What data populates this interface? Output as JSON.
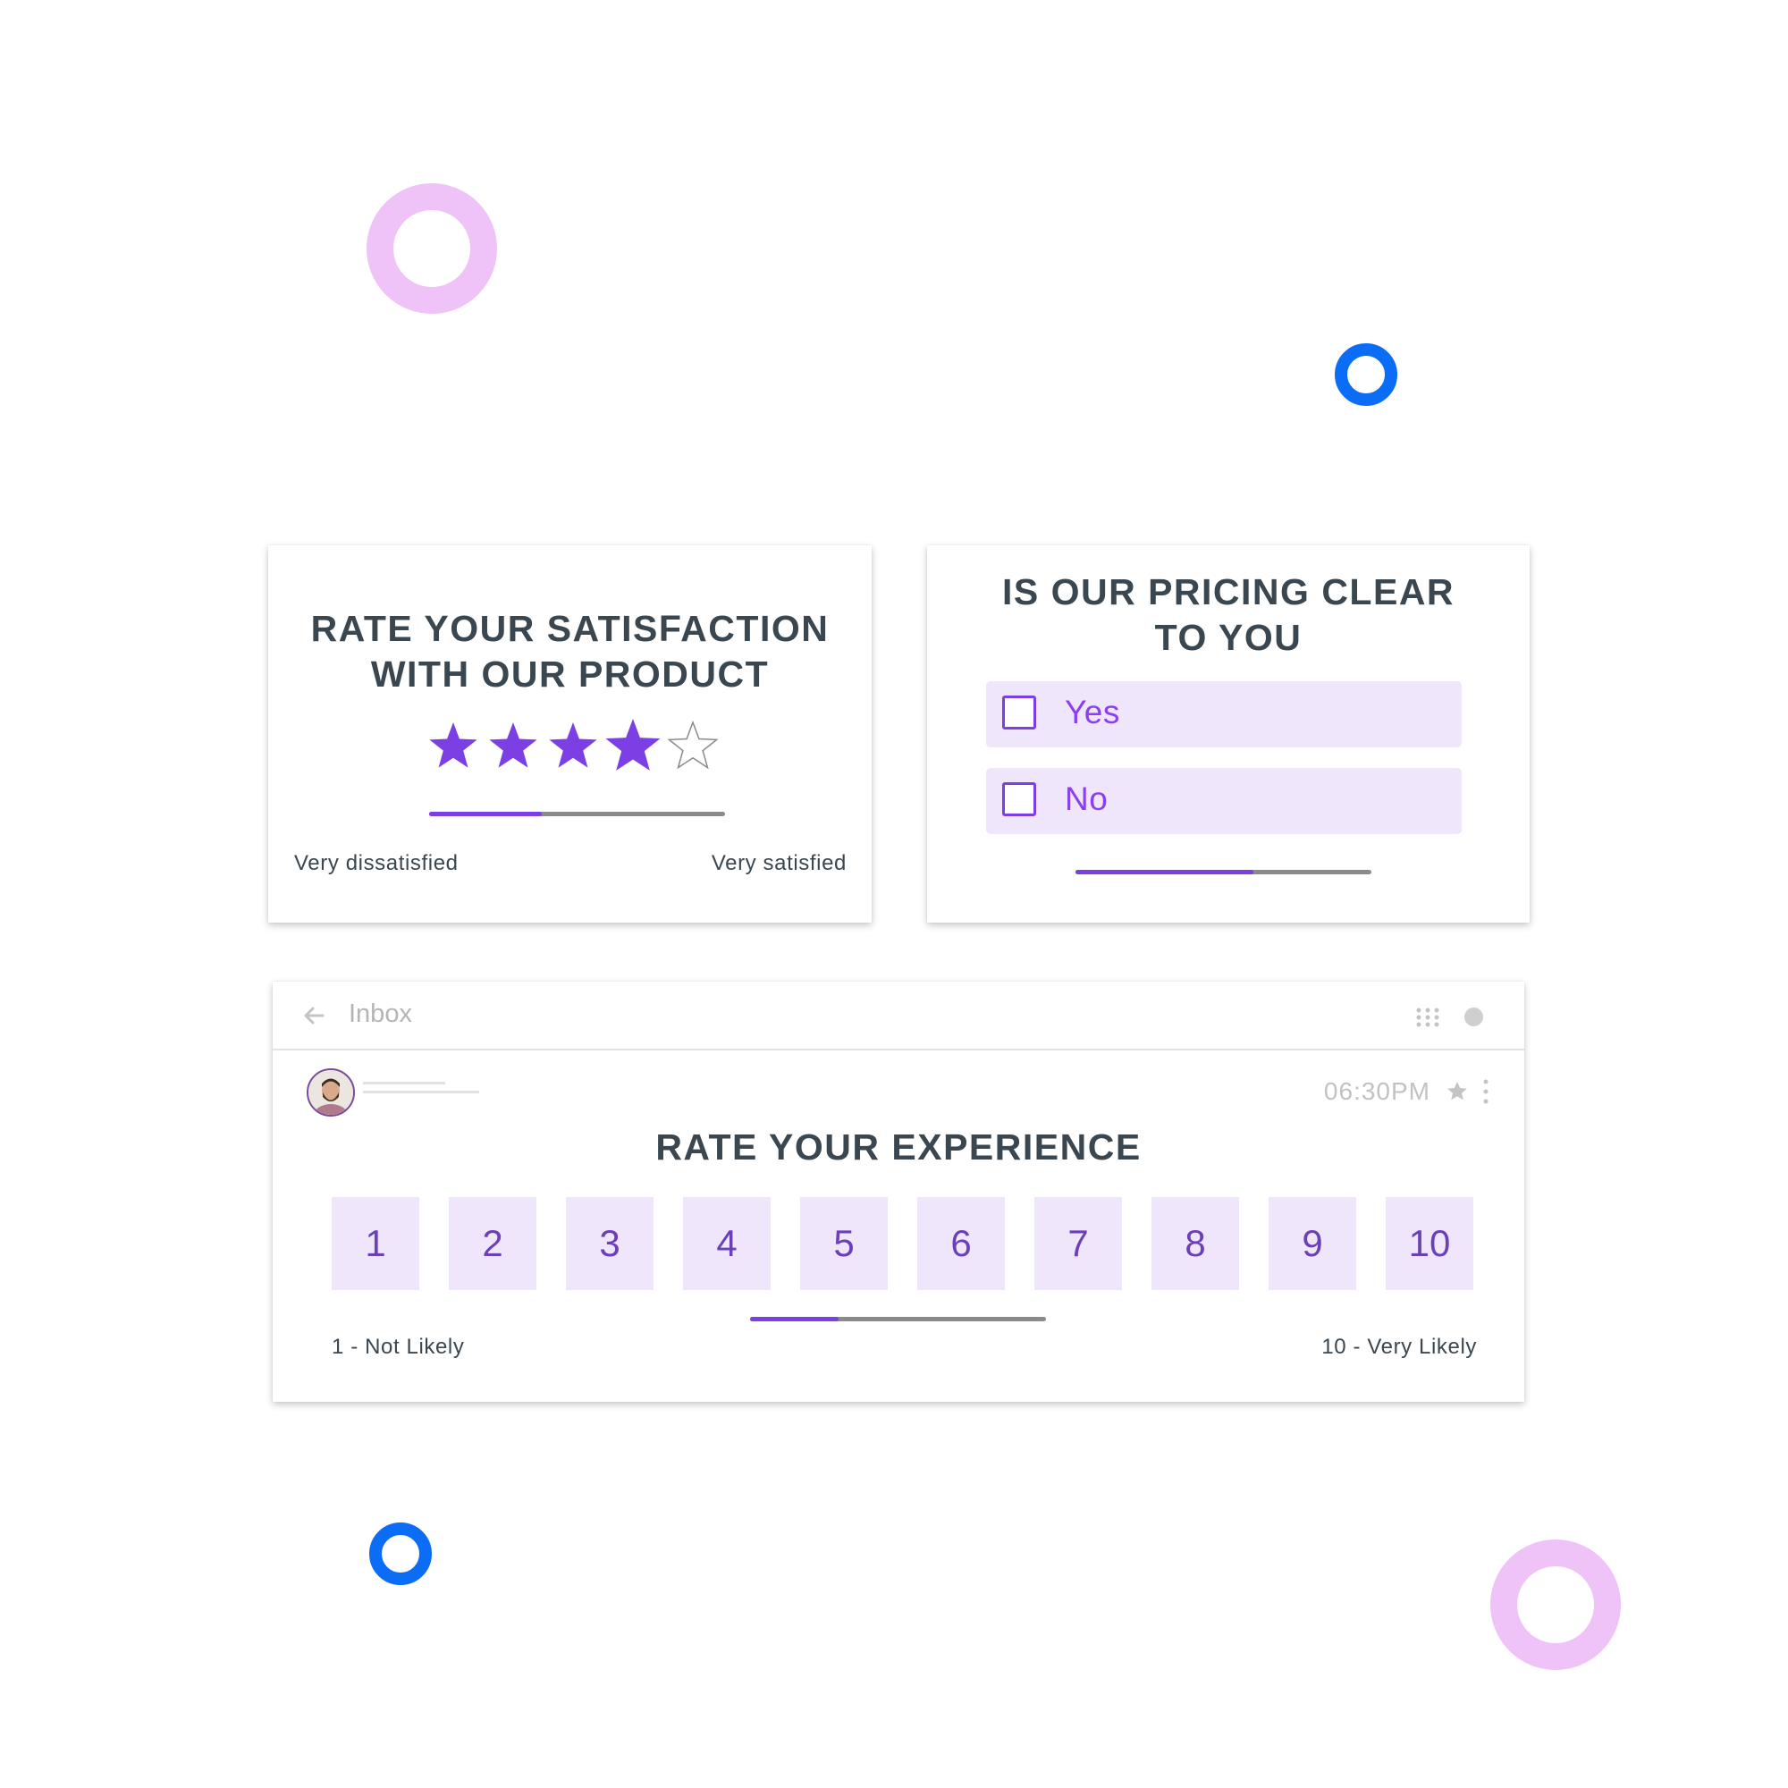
{
  "colors": {
    "accent": "#7b3fe4",
    "option_bg": "#f0e6fc",
    "decor_pink": "#efc2f8",
    "decor_blue": "#0b6cf5",
    "heading": "#3a4750"
  },
  "satisfaction_card": {
    "title_line1": "RATE YOUR SATISFACTION",
    "title_line2": "WITH OUR PRODUCT",
    "rating": 4,
    "max_rating": 5,
    "progress": 0.38,
    "label_low": "Very dissatisfied",
    "label_high": "Very satisfied"
  },
  "pricing_card": {
    "title_line1": "IS OUR PRICING CLEAR",
    "title_line2": "TO YOU",
    "options": [
      {
        "label": "Yes",
        "checked": false
      },
      {
        "label": "No",
        "checked": false
      }
    ],
    "progress": 0.6
  },
  "email_card": {
    "header": {
      "back_icon": "arrow-left-icon",
      "title": "Inbox",
      "apps_icon": "grid-icon"
    },
    "time": "06:30PM",
    "title": "RATE YOUR EXPERIENCE",
    "scale": [
      "1",
      "2",
      "3",
      "4",
      "5",
      "6",
      "7",
      "8",
      "9",
      "10"
    ],
    "progress": 0.3,
    "label_low": "1 - Not Likely",
    "label_high": "10 - Very Likely"
  }
}
